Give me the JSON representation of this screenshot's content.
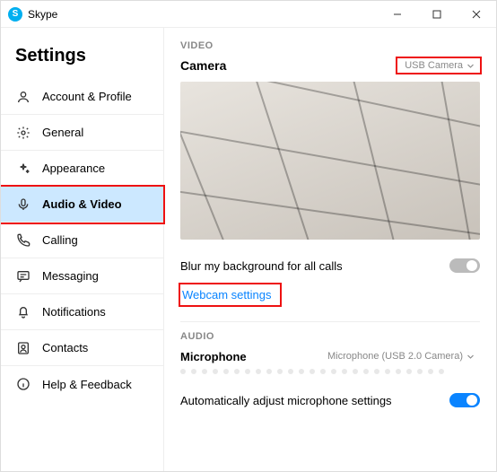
{
  "title": "Skype",
  "sidebar": {
    "heading": "Settings",
    "items": [
      {
        "label": "Account & Profile"
      },
      {
        "label": "General"
      },
      {
        "label": "Appearance"
      },
      {
        "label": "Audio & Video"
      },
      {
        "label": "Calling"
      },
      {
        "label": "Messaging"
      },
      {
        "label": "Notifications"
      },
      {
        "label": "Contacts"
      },
      {
        "label": "Help & Feedback"
      }
    ]
  },
  "video": {
    "section": "VIDEO",
    "camera_label": "Camera",
    "camera_selected": "USB Camera",
    "blur_label": "Blur my background for all calls",
    "webcam_link": "Webcam settings"
  },
  "audio": {
    "section": "AUDIO",
    "mic_label": "Microphone",
    "mic_selected": "Microphone (USB 2.0 Camera)",
    "auto_label": "Automatically adjust microphone settings"
  }
}
